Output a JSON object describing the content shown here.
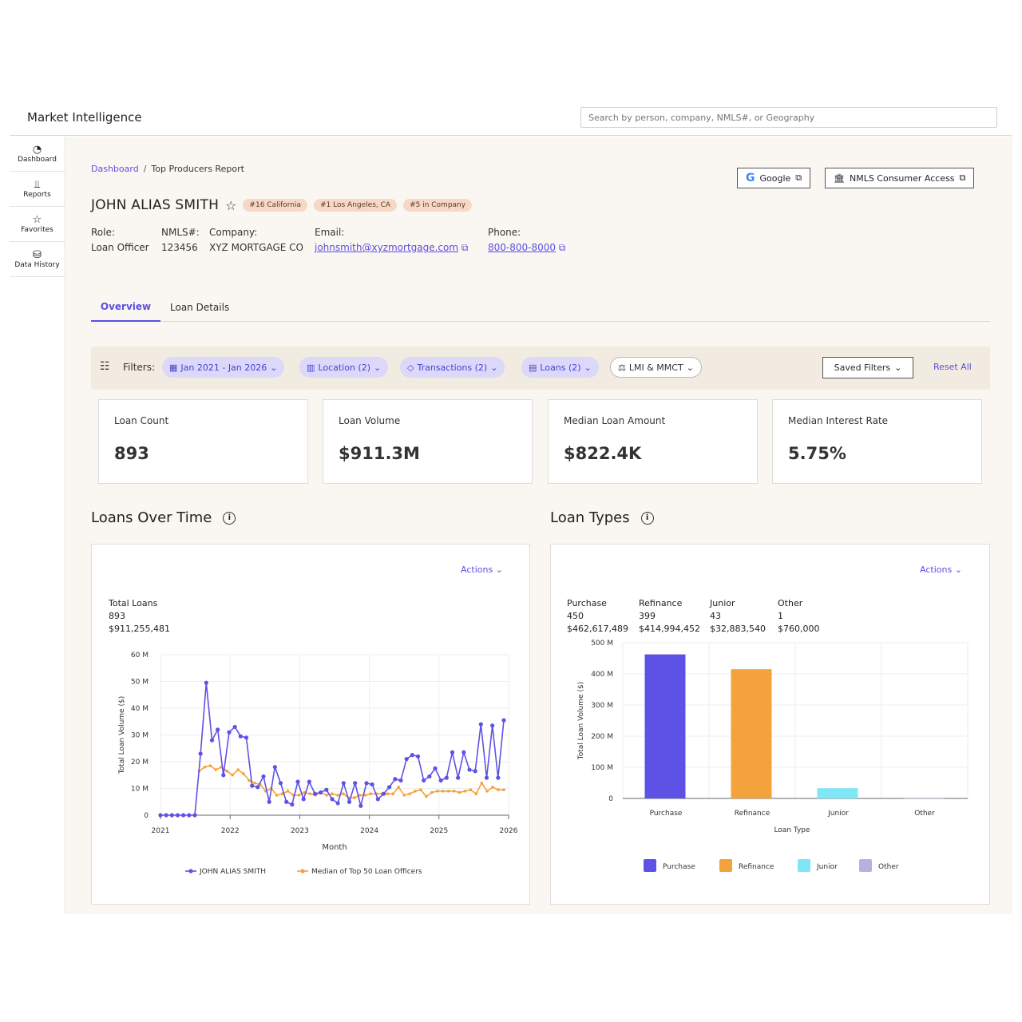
{
  "app": {
    "title": "Market Intelligence",
    "search_placeholder": "Search by person, company, NMLS#, or Geography"
  },
  "sidebar": {
    "items": [
      {
        "label": "Dashboard",
        "icon": "gauge-icon"
      },
      {
        "label": "Reports",
        "icon": "chart-icon"
      },
      {
        "label": "Favorites",
        "icon": "star-icon"
      },
      {
        "label": "Data History",
        "icon": "database-icon"
      }
    ]
  },
  "breadcrumb": {
    "root": "Dashboard",
    "sep": "/",
    "current": "Top Producers Report"
  },
  "external": {
    "google": "Google",
    "nmls": "NMLS Consumer Access"
  },
  "person": {
    "name": "JOHN ALIAS SMITH",
    "badges": [
      "#16 California",
      "#1 Los Angeles, CA",
      "#5 in Company"
    ],
    "role_label": "Role:",
    "role": "Loan Officer",
    "nmls_label": "NMLS#:",
    "nmls": "123456",
    "company_label": "Company:",
    "company": "XYZ MORTGAGE CO",
    "email_label": "Email:",
    "email": "johnsmith@xyzmortgage.com",
    "phone_label": "Phone:",
    "phone": "800-800-8000"
  },
  "tabs": [
    "Overview",
    "Loan Details"
  ],
  "filters": {
    "label": "Filters:",
    "chips": [
      "Jan 2021 - Jan 2026",
      "Location (2)",
      "Transactions (2)",
      "Loans (2)",
      "LMI & MMCT"
    ],
    "saved": "Saved Filters",
    "reset": "Reset All"
  },
  "kpis": [
    {
      "label": "Loan Count",
      "value": "893"
    },
    {
      "label": "Loan Volume",
      "value": "$911.3M"
    },
    {
      "label": "Median Loan Amount",
      "value": "$822.4K"
    },
    {
      "label": "Median Interest Rate",
      "value": "5.75%"
    }
  ],
  "sections": {
    "loans_over_time": "Loans Over Time",
    "loan_types": "Loan Types",
    "actions": "Actions"
  },
  "line_totals": {
    "title": "Total Loans",
    "count": "893",
    "volume": "$911,255,481"
  },
  "bar_totals": [
    {
      "name": "Purchase",
      "count": "450",
      "volume": "$462,617,489"
    },
    {
      "name": "Refinance",
      "count": "399",
      "volume": "$414,994,452"
    },
    {
      "name": "Junior",
      "count": "43",
      "volume": "$32,883,540"
    },
    {
      "name": "Other",
      "count": "1",
      "volume": "$760,000"
    }
  ],
  "colors": {
    "accent": "#5b4fe0",
    "series1": "#5e52e6",
    "series2": "#f4a23b",
    "purchase": "#5e52e6",
    "refinance": "#f4a23b",
    "junior": "#7fe6f5",
    "other": "#b9b0e0"
  },
  "chart_data": [
    {
      "type": "line",
      "xlabel": "Month",
      "ylabel": "Total Loan Volume ($)",
      "xlim": [
        2021,
        2026
      ],
      "ylim": [
        0,
        60
      ],
      "y_ticks": [
        "0",
        "10 M",
        "20 M",
        "30 M",
        "40 M",
        "50 M",
        "60 M"
      ],
      "x_ticks": [
        "2021",
        "2022",
        "2023",
        "2024",
        "2025",
        "2026"
      ],
      "series": [
        {
          "name": "JOHN ALIAS SMITH",
          "values": [
            0,
            0,
            0,
            0,
            0,
            0,
            0,
            23,
            49.5,
            28,
            32,
            15,
            31,
            33,
            29.5,
            29,
            11,
            10.5,
            14.5,
            5,
            18,
            12,
            5,
            4,
            12.5,
            6,
            12.5,
            8,
            8.5,
            9.5,
            6,
            4.5,
            12,
            5,
            12,
            3.5,
            12,
            11.5,
            6,
            8,
            10.5,
            13.5,
            13,
            21,
            22.5,
            22,
            13,
            14.5,
            17.5,
            13,
            14,
            23.5,
            14,
            23.5,
            17,
            16.5,
            34,
            14,
            33.5,
            14,
            35.5
          ]
        },
        {
          "name": "Median of Top 50 Loan Officers",
          "values": [
            null,
            null,
            null,
            null,
            null,
            null,
            null,
            16.5,
            18,
            18.5,
            17,
            18,
            16.5,
            15,
            17,
            15.5,
            13,
            12,
            11.5,
            9,
            10,
            7.5,
            8,
            9,
            7.5,
            7.5,
            8.5,
            8,
            7.5,
            8.5,
            7.5,
            8,
            7.5,
            8,
            6.5,
            6.5,
            7.5,
            7.5,
            8,
            8,
            8,
            8,
            8,
            10.5,
            7.5,
            8,
            9,
            9.5,
            7,
            8.5,
            9,
            9,
            9,
            9,
            8.5,
            9,
            9.5,
            8,
            12,
            9,
            10.5,
            9.5,
            9.5
          ]
        }
      ]
    },
    {
      "type": "bar",
      "xlabel": "Loan Type",
      "ylabel": "Total Loan Volume ($)",
      "categories": [
        "Purchase",
        "Refinance",
        "Junior",
        "Other"
      ],
      "values": [
        462.6,
        415.0,
        32.9,
        0.76
      ],
      "ylim": [
        0,
        500
      ],
      "y_ticks": [
        "0",
        "100 M",
        "200 M",
        "300 M",
        "400 M",
        "500 M"
      ]
    }
  ]
}
